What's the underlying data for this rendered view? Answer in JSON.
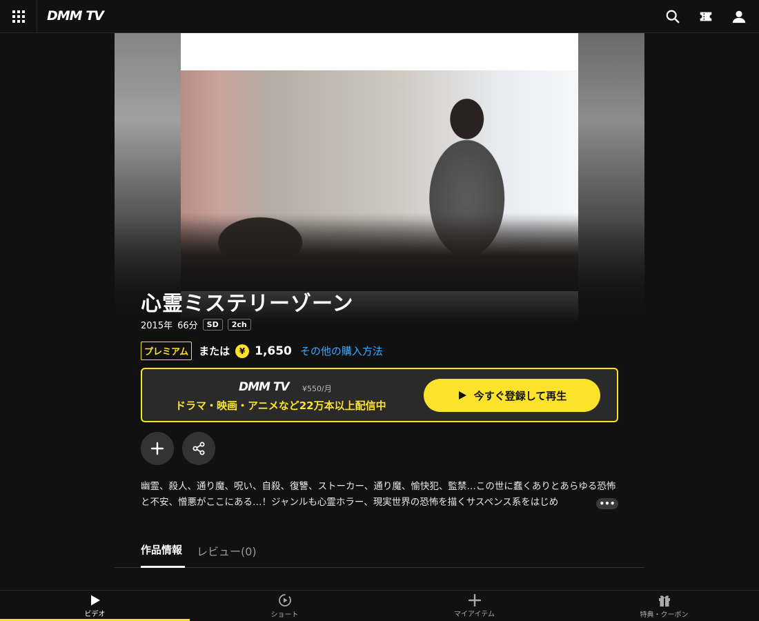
{
  "header": {
    "logo": "DMM TV",
    "menu_icon": "grid-icon",
    "search_icon": "search-icon",
    "ticket_icon": "ticket-icon",
    "account_icon": "user-icon"
  },
  "title": {
    "main": "心霊ミステリーゾーン",
    "year": "2015年",
    "duration": "66分",
    "badges": [
      "SD",
      "2ch"
    ]
  },
  "pricing": {
    "premium_label": "プレミアム",
    "or_label": "または",
    "yen_symbol": "¥",
    "price": "1,650",
    "other_methods_link": "その他の購入方法"
  },
  "promo": {
    "logo": "DMM TV",
    "monthly_price": "¥550/月",
    "description": "ドラマ・映画・アニメなど22万本以上配信中",
    "cta_label": "今すぐ登録して再生"
  },
  "actions": {
    "add_icon": "plus-icon",
    "share_icon": "share-icon"
  },
  "description": {
    "text": "幽霊、殺人、通り魔、呪い、自殺、復讐、ストーカー、通り魔、愉快犯、監禁…この世に蠢くありとあらゆる恐怖と不安、憎悪がここにある…！ジャンルも心霊ホラー、現実世界の恐怖を描くサスペンス系をはじめ",
    "more": "•••"
  },
  "tabs": {
    "info": "作品情報",
    "review": "レビュー(0)"
  },
  "bottom_nav": [
    {
      "label": "ビデオ",
      "icon": "play-icon",
      "active": true
    },
    {
      "label": "ショート",
      "icon": "short-play-icon",
      "active": false
    },
    {
      "label": "マイアイテム",
      "icon": "plus-icon",
      "active": false
    },
    {
      "label": "特典・クーポン",
      "icon": "gift-icon",
      "active": false
    }
  ],
  "colors": {
    "accent": "#fbe32c",
    "link": "#3ea8ff",
    "background": "#111111"
  }
}
